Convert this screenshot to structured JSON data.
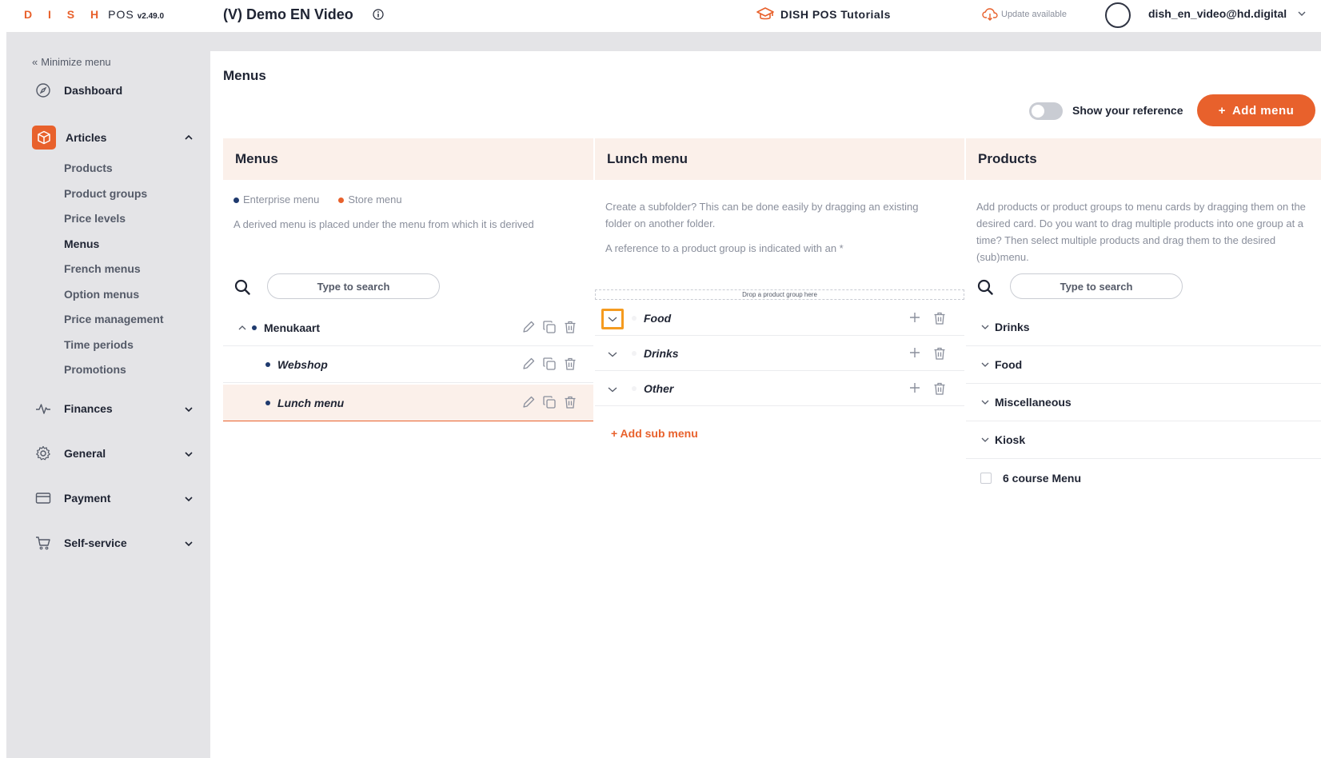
{
  "topbar": {
    "brand": "D I S H",
    "brand_pos": "POS",
    "version": "v2.49.0",
    "account": "(V) Demo EN Video",
    "tutorials": "DISH POS Tutorials",
    "update": "Update available",
    "user_email": "dish_en_video@hd.digital"
  },
  "sidebar": {
    "minimize": "Minimize menu",
    "dashboard": "Dashboard",
    "articles": "Articles",
    "articles_items": [
      "Products",
      "Product groups",
      "Price levels",
      "Menus",
      "French menus",
      "Option menus",
      "Price management",
      "Time periods",
      "Promotions"
    ],
    "finances": "Finances",
    "general": "General",
    "payment": "Payment",
    "self_service": "Self-service"
  },
  "page": {
    "title": "Menus",
    "toggle_label": "Show your reference",
    "add_menu": "Add menu"
  },
  "colors": {
    "accent": "#e8612c",
    "highlight": "#f59b1f",
    "enterprise_dot": "#1f3a6e"
  },
  "menus_col": {
    "header": "Menus",
    "legend_enterprise": "Enterprise menu",
    "legend_store": "Store menu",
    "description": "A derived menu is placed under the menu from which it is derived",
    "search_placeholder": "Type to search",
    "rows": [
      {
        "label": "Menukaart"
      },
      {
        "label": "Webshop"
      },
      {
        "label": "Lunch menu"
      }
    ]
  },
  "lunch_col": {
    "header": "Lunch menu",
    "description1": "Create a subfolder? This can be done easily by dragging an existing folder on another folder.",
    "description2": "A reference to a product group is indicated with an *",
    "drop_zone": "Drop a product group here",
    "rows": [
      {
        "label": "Food"
      },
      {
        "label": "Drinks"
      },
      {
        "label": "Other"
      }
    ],
    "add_sub": "+ Add sub menu"
  },
  "products_col": {
    "header": "Products",
    "description": "Add products or product groups to menu cards by dragging them on the desired card. Do you want to drag multiple products into one group at a time? Then select multiple products and drag them to the desired (sub)menu.",
    "search_placeholder": "Type to search",
    "groups": [
      {
        "label": "Drinks"
      },
      {
        "label": "Food"
      },
      {
        "label": "Miscellaneous"
      },
      {
        "label": "Kiosk"
      }
    ],
    "item": "6 course Menu"
  }
}
